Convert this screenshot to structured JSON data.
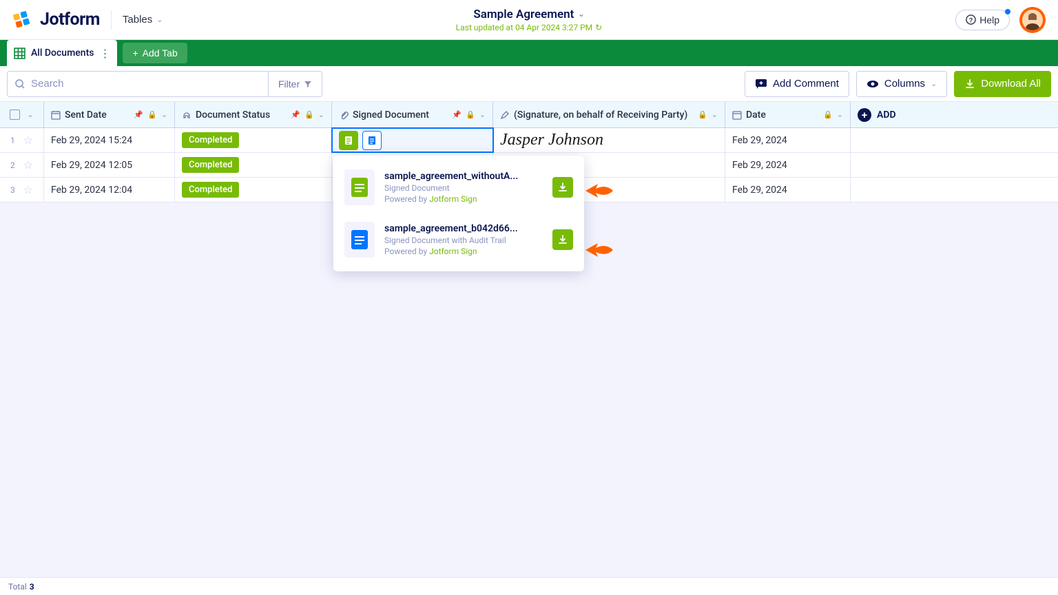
{
  "header": {
    "logo_text": "Jotform",
    "tables_label": "Tables",
    "doc_title": "Sample Agreement",
    "last_updated": "Last updated at 04 Apr 2024 3:27 PM",
    "help_label": "Help"
  },
  "tabs": {
    "active_label": "All Documents",
    "add_tab_label": "Add Tab"
  },
  "toolbar": {
    "search_placeholder": "Search",
    "filter_label": "Filter",
    "add_comment_label": "Add Comment",
    "columns_label": "Columns",
    "download_all_label": "Download All"
  },
  "columns": {
    "sent_date": "Sent Date",
    "document_status": "Document Status",
    "signed_document": "Signed Document",
    "signature": "(Signature, on behalf of Receiving Party)",
    "date": "Date",
    "add": "ADD"
  },
  "rows": [
    {
      "num": "1",
      "sent": "Feb 29, 2024 15:24",
      "status": "Completed",
      "signature": "Jasper Johnson",
      "date": "Feb 29, 2024"
    },
    {
      "num": "2",
      "sent": "Feb 29, 2024 12:05",
      "status": "Completed",
      "signature": "",
      "date": "Feb 29, 2024"
    },
    {
      "num": "3",
      "sent": "Feb 29, 2024 12:04",
      "status": "Completed",
      "signature": "",
      "date": "Feb 29, 2024"
    }
  ],
  "dropdown": {
    "items": [
      {
        "name": "sample_agreement_withoutA...",
        "sub": "Signed Document",
        "powered_prefix": "Powered by ",
        "powered_brand": "Jotform Sign",
        "icon": "green"
      },
      {
        "name": "sample_agreement_b042d66...",
        "sub": "Signed Document with Audit Trail",
        "powered_prefix": "Powered by ",
        "powered_brand": "Jotform Sign",
        "icon": "blue"
      }
    ]
  },
  "footer": {
    "total_label": "Total",
    "total_count": "3"
  }
}
